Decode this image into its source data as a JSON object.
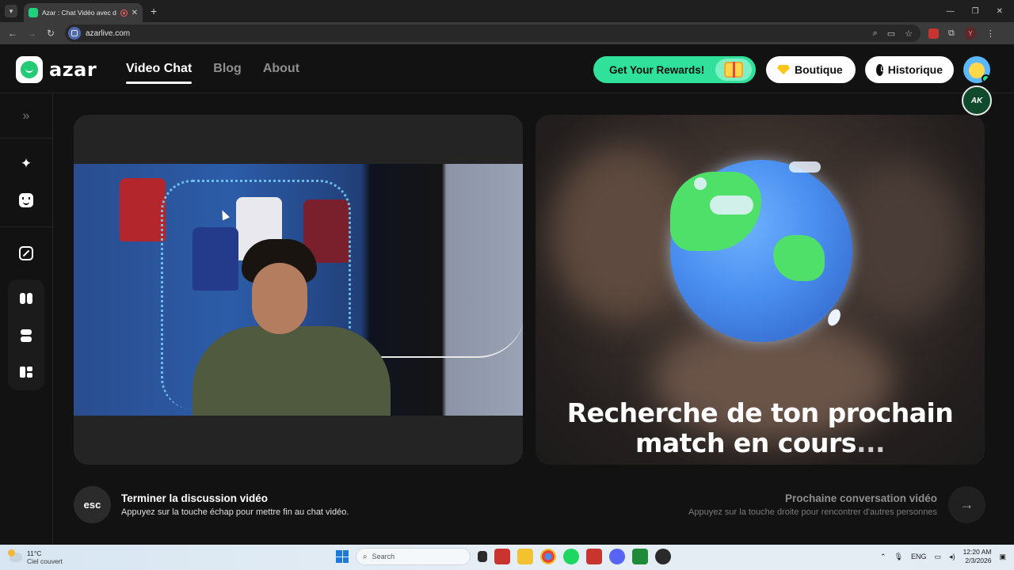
{
  "browser": {
    "tab_title": "Azar : Chat Vidéo avec de n",
    "url": "azarlive.com"
  },
  "header": {
    "logo_text": "azar",
    "nav": [
      {
        "label": "Video Chat"
      },
      {
        "label": "Blog"
      },
      {
        "label": "About"
      }
    ],
    "rewards_label": "Get Your Rewards!",
    "boutique_label": "Boutique",
    "history_label": "Historique",
    "badge_text": "AK"
  },
  "main": {
    "search_line1": "Recherche de ton prochain",
    "search_line2": "match en cours",
    "search_dots": "..."
  },
  "footer": {
    "esc_key": "esc",
    "end_title": "Terminer la discussion vidéo",
    "end_desc": "Appuyez sur la touche échap pour mettre fin au chat vidéo.",
    "next_title": "Prochaine conversation vidéo",
    "next_desc": "Appuyez sur la touche droite pour rencontrer d'autres personnes"
  },
  "taskbar": {
    "temperature": "11°C",
    "weather_desc": "Ciel couvert",
    "search_label": "Search",
    "language": "ENG",
    "time": "12:20 AM",
    "date": "2/3/2026"
  },
  "colors": {
    "accent_green": "#2fe19a",
    "background": "#121212"
  }
}
